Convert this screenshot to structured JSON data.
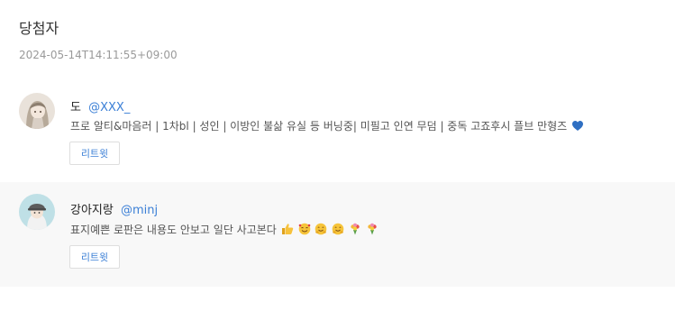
{
  "page": {
    "title": "당첨자",
    "timestamp": "2024-05-14T14:11:55+09:00"
  },
  "entries": [
    {
      "display_name": "도",
      "handle": "@XXX_",
      "bio": "프로 알티&마음러 | 1차bl | 성인 | 이방인 불삶 유실 등 버닝중| 미필고 인연 무덤 | 중독 고죠후시 플브 만형즈",
      "bio_emoji": [
        "blue-heart-icon"
      ],
      "retweet_label": "리트윗"
    },
    {
      "display_name": "강아지랑",
      "handle": "@minj",
      "bio": "표지예쁜 로판은 내용도 안보고 일단 사고본다",
      "bio_emoji": [
        "thumbs-up-icon",
        "smiling-hearts-icon",
        "hugging-face-icon",
        "hugging-face-icon",
        "bouquet-icon",
        "bouquet-icon"
      ],
      "retweet_label": "리트윗"
    }
  ]
}
